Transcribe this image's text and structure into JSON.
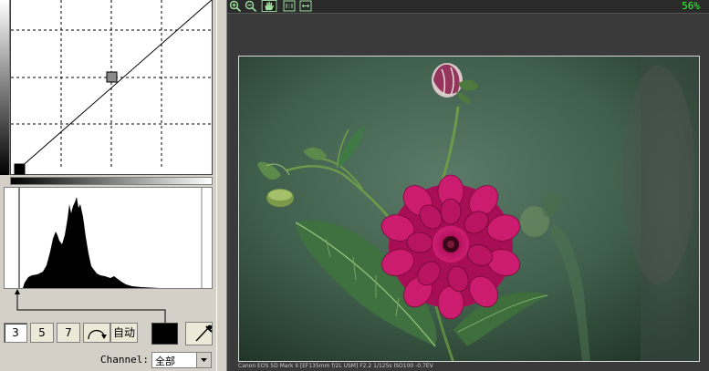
{
  "tone_buttons": {
    "b3": "3",
    "b5": "5",
    "b7": "7",
    "auto": "自动"
  },
  "channel": {
    "label": "Channel:",
    "value": "全部"
  },
  "viewer": {
    "zoom": "56%",
    "caption": "Canon EOS 5D Mark II  [EF135mm f/2L USM] F2.2 1/125s ISO100 -0.7EV"
  },
  "icons": {
    "zoom_in": "zoom-in-icon",
    "zoom_out": "zoom-out-icon",
    "hand": "hand-icon",
    "actual_size": "actual-size-icon",
    "fit_width": "fit-width-icon",
    "curve": "curve-icon",
    "eyedropper": "eyedropper-icon"
  },
  "colors": {
    "zoom_text": "#33ff33",
    "swatch": "#000000"
  }
}
